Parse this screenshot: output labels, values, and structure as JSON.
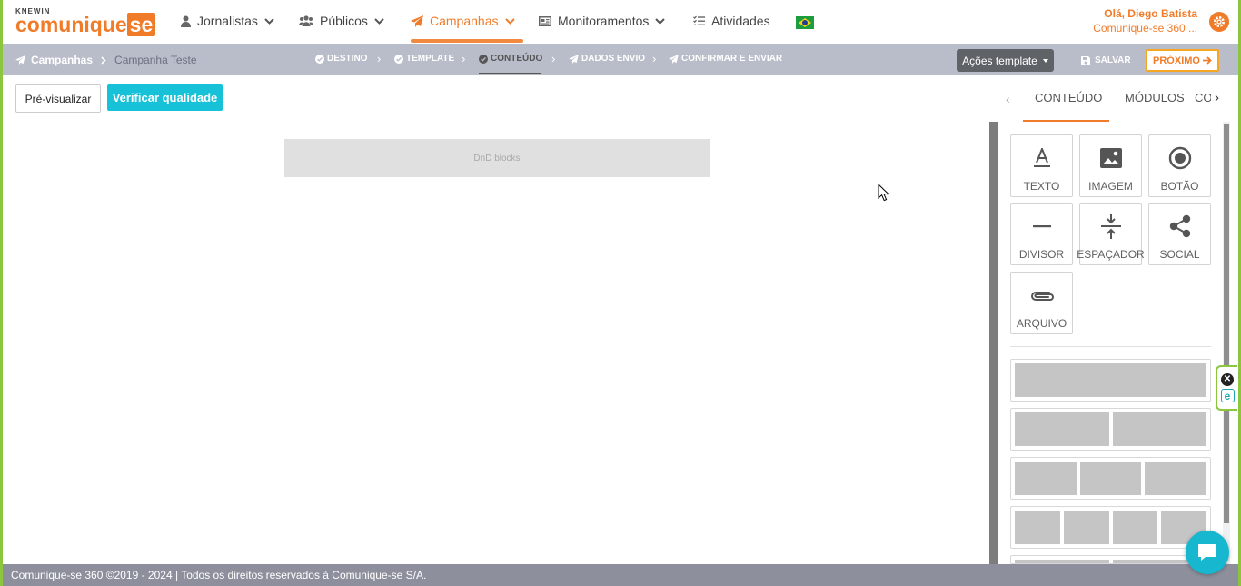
{
  "brand": {
    "small": "KNEWIN",
    "name_main": "comunique",
    "name_se": "se"
  },
  "nav": {
    "items": [
      {
        "label": "Jornalistas",
        "icon": "user-icon"
      },
      {
        "label": "Públicos",
        "icon": "users-icon"
      },
      {
        "label": "Campanhas",
        "icon": "paper-plane-icon",
        "active": true
      },
      {
        "label": "Monitoramentos",
        "icon": "newspaper-icon"
      },
      {
        "label": "Atividades",
        "icon": "list-check-icon"
      }
    ],
    "language_flag": "brazil-flag-icon"
  },
  "user": {
    "greeting": "Olá, Diego Batista",
    "org": "Comunique-se 360 ..."
  },
  "breadcrumb": {
    "root": "Campanhas",
    "current": "Campanha Teste"
  },
  "steps": [
    {
      "label": "DESTINO"
    },
    {
      "label": "TEMPLATE"
    },
    {
      "label": "CONTEÚDO",
      "current": true
    },
    {
      "label": "DADOS ENVIO"
    },
    {
      "label": "CONFIRMAR E ENVIAR"
    }
  ],
  "actions": {
    "template_actions": "Ações template",
    "save": "SALVAR",
    "next": "PRÓXIMO"
  },
  "editor": {
    "preview": "Pré-visualizar",
    "verify": "Verificar qualidade",
    "dnd_placeholder": "DnD blocks"
  },
  "panel": {
    "tabs": [
      {
        "label": "CONTEÚDO",
        "active": true
      },
      {
        "label": "MÓDULOS"
      },
      {
        "label": "CO"
      }
    ],
    "blocks": [
      {
        "label": "TEXTO",
        "icon": "text-icon"
      },
      {
        "label": "IMAGEM",
        "icon": "image-icon"
      },
      {
        "label": "BOTÃO",
        "icon": "button-icon"
      },
      {
        "label": "DIVISOR",
        "icon": "divider-icon"
      },
      {
        "label": "ESPAÇADOR",
        "icon": "spacer-icon"
      },
      {
        "label": "SOCIAL",
        "icon": "share-icon"
      },
      {
        "label": "ARQUIVO",
        "icon": "paperclip-icon"
      }
    ],
    "layouts": [
      1,
      2,
      3,
      4
    ]
  },
  "footer": {
    "text": "Comunique-se 360 ©2019 - 2024 | Todos os direitos reservados à Comunique-se S/A."
  },
  "colors": {
    "accent": "#f07c2a",
    "teal": "#17c1d8",
    "subbar": "#b9bcc9",
    "footer": "#8d909c",
    "frame": "#8cc63f"
  }
}
